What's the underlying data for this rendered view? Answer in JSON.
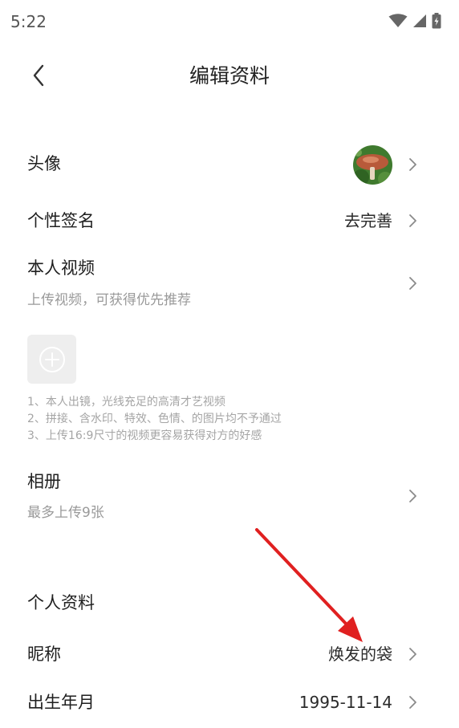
{
  "status_bar": {
    "time": "5:22",
    "icons": [
      "wifi-icon",
      "signal-icon",
      "battery-charging-icon"
    ]
  },
  "header": {
    "back_icon": "chevron-left-icon",
    "title": "编辑资料"
  },
  "avatar_row": {
    "label": "头像"
  },
  "signature_row": {
    "label": "个性签名",
    "value": "去完善"
  },
  "video_row": {
    "label": "本人视频",
    "hint": "上传视频，可获得优先推荐",
    "upload_icon": "plus-circle-icon",
    "tips": [
      "1、本人出镜，光线充足的高清才艺视频",
      "2、拼接、含水印、特效、色情、的图片均不予通过",
      "3、上传16:9尺寸的视频更容易获得对方的好感"
    ]
  },
  "album_row": {
    "label": "相册",
    "hint": "最多上传9张"
  },
  "profile_section": {
    "title": "个人资料",
    "nickname_label": "昵称",
    "nickname_value": "焕发的袋",
    "birthday_label": "出生年月",
    "birthday_value": "1995-11-14"
  },
  "annotation": {
    "arrow_color": "#e02020"
  },
  "colors": {
    "text_primary": "#1f1f1f",
    "text_secondary": "#9a9a9a",
    "chevron": "#8a8a8a",
    "tile_bg": "#eeeeee"
  }
}
